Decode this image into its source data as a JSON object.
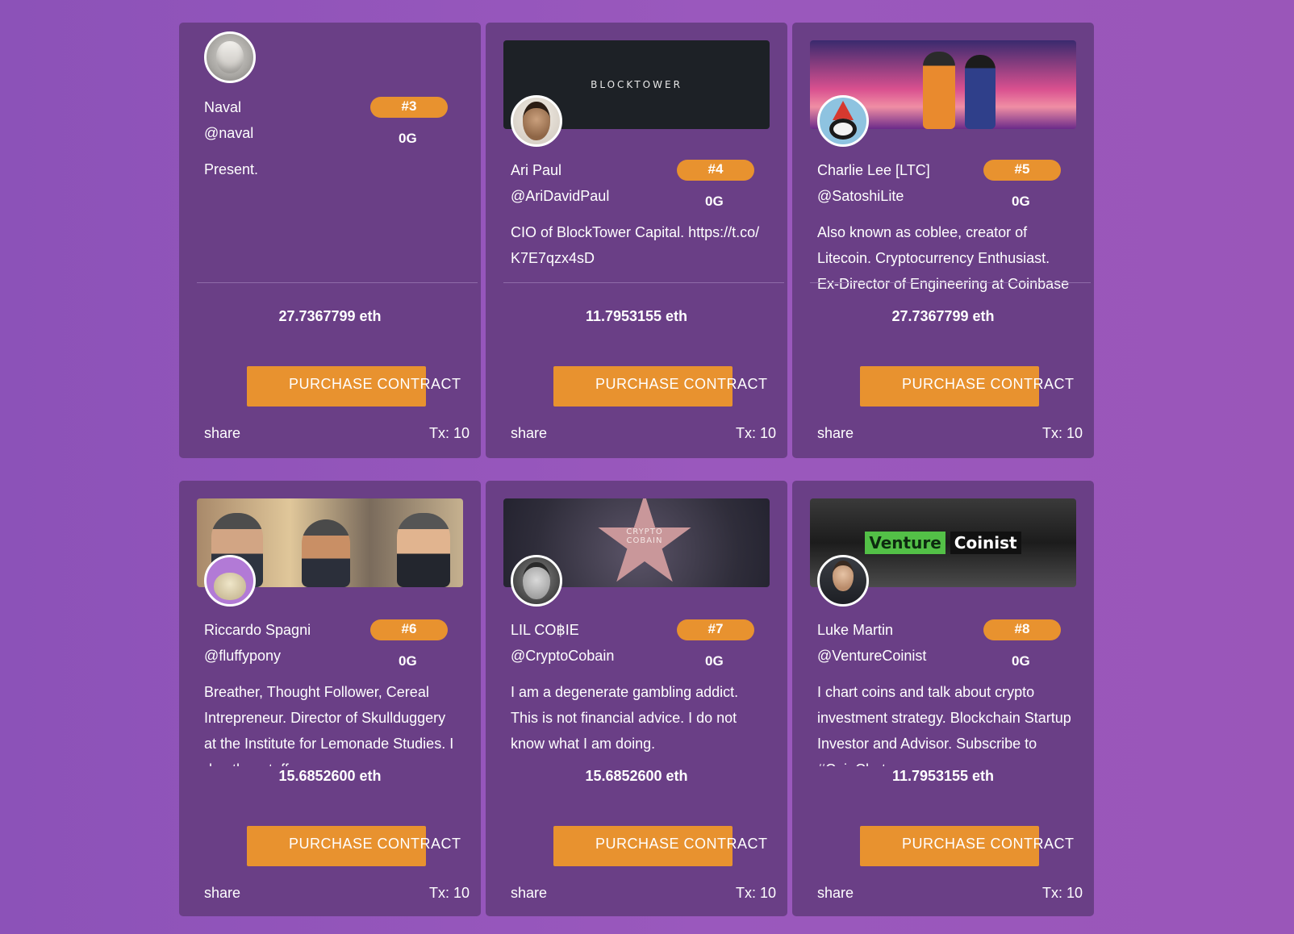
{
  "cards": [
    {
      "rank": "#3",
      "name": "Naval",
      "handle": "@naval",
      "gen": "0G",
      "bio": "Present.",
      "price": "27.7367799 eth",
      "button": "PURCHASE CONTRACT",
      "share": "share",
      "tx": "Tx: 10",
      "avatar_icon": "robot-face-avatar"
    },
    {
      "rank": "#4",
      "name": "Ari Paul",
      "handle": "@AriDavidPaul",
      "gen": "0G",
      "bio": "CIO of BlockTower Capital. https://t.co/K7E7qzx4sD",
      "price": "11.7953155 eth",
      "button": "PURCHASE CONTRACT",
      "share": "share",
      "tx": "Tx: 10",
      "banner_text": "BLOCKTOWER",
      "avatar_icon": "person-photo-avatar"
    },
    {
      "rank": "#5",
      "name": "Charlie Lee [LTC]",
      "handle": "@SatoshiLite",
      "gen": "0G",
      "bio": "Also known as coblee, creator of Litecoin. Cryptocurrency Enthusiast. Ex-Director of Engineering at Coinbase",
      "price": "27.7367799 eth",
      "button": "PURCHASE CONTRACT",
      "share": "share",
      "tx": "Tx: 10",
      "avatar_icon": "cartoon-gnome-avatar"
    },
    {
      "rank": "#6",
      "name": "Riccardo Spagni",
      "handle": "@fluffypony",
      "gen": "0G",
      "bio": "Breather, Thought Follower, Cereal Intrepreneur. Director of Skullduggery at the Institute for Lemonade Studies. I do other stuff",
      "price": "15.6852600 eth",
      "button": "PURCHASE CONTRACT",
      "share": "share",
      "tx": "Tx: 10",
      "avatar_icon": "cartoon-pony-avatar"
    },
    {
      "rank": "#7",
      "name": "LIL CO฿IE",
      "handle": "@CryptoCobain",
      "gen": "0G",
      "bio": "I am a degenerate gambling addict. This is not financial advice. I do not know what I am doing.",
      "price": "15.6852600 eth",
      "button": "PURCHASE CONTRACT",
      "share": "share",
      "tx": "Tx: 10",
      "banner_text": "CRYPTO COBAIN",
      "avatar_icon": "sunglasses-person-avatar"
    },
    {
      "rank": "#8",
      "name": "Luke Martin",
      "handle": "@VentureCoinist",
      "gen": "0G",
      "bio": "I chart coins and talk about crypto investment strategy. Blockchain Startup Investor and Advisor. Subscribe to #CoinChat:",
      "price": "11.7953155 eth",
      "button": "PURCHASE CONTRACT",
      "share": "share",
      "tx": "Tx: 10",
      "banner_text_1": "Venture",
      "banner_text_2": "Coinist",
      "avatar_icon": "person-suit-avatar"
    }
  ]
}
